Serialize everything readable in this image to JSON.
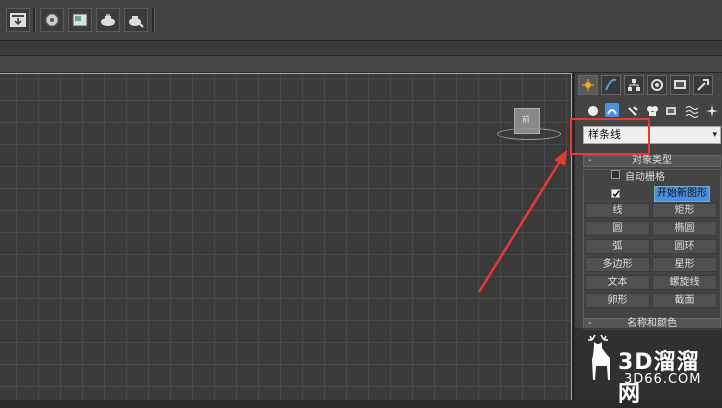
{
  "toolbar": {
    "icons": [
      "render-frame-icon",
      "render-setup-icon",
      "rendered-frame-window-icon",
      "render-production-icon",
      "render-iterative-icon"
    ]
  },
  "viewport": {
    "viewcube_label": "前"
  },
  "command_panel": {
    "tabs": [
      "create-tab",
      "modify-tab",
      "hierarchy-tab",
      "motion-tab",
      "display-tab",
      "utilities-tab"
    ],
    "subcategories": [
      "geometry-icon",
      "shapes-icon",
      "lights-icon",
      "cameras-icon",
      "helpers-icon",
      "space-warps-icon",
      "systems-icon"
    ],
    "dropdown_value": "样条线",
    "object_type": {
      "title": "对象类型",
      "autogrid_label": "自动栅格",
      "start_new_shape_label": "开始新图形",
      "buttons": [
        [
          "线",
          "矩形"
        ],
        [
          "圆",
          "椭圆"
        ],
        [
          "弧",
          "圆环"
        ],
        [
          "多边形",
          "星形"
        ],
        [
          "文本",
          "螺旋线"
        ],
        [
          "卵形",
          "截面"
        ]
      ]
    },
    "name_color": {
      "title": "名称和颜色"
    }
  },
  "watermark": {
    "brand": "3D溜溜网",
    "domain": "3D66.COM"
  },
  "colors": {
    "highlight": "#e53935",
    "active_button": "#4a90e2"
  }
}
